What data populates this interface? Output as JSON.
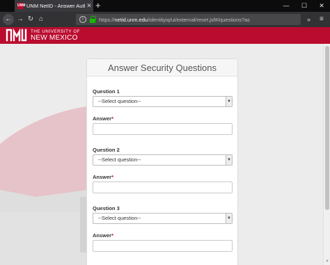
{
  "browser": {
    "tab_title": "UNM NetID - Answer Authentic",
    "favicon_text": "UNM",
    "new_tab_label": "+",
    "url_host": "netid.unm.edu",
    "url_prefix": "https://",
    "url_rest": "/identityiq/ui/external/reset.jsf#/questions?ac",
    "overflow_label": "»",
    "menu_label": "≡",
    "minimize_label": "—",
    "maximize_label": "☐",
    "close_label": "✕"
  },
  "header": {
    "logo_line1": "THE UNIVERSITY OF",
    "logo_line2": "NEW MEXICO",
    "brand_color": "#ba0c2f"
  },
  "form": {
    "title": "Answer Security Questions",
    "required_marker": "*",
    "questions": [
      {
        "label": "Question 1",
        "select_value": "--Select question--",
        "answer_label": "Answer"
      },
      {
        "label": "Question 2",
        "select_value": "--Select question--",
        "answer_label": "Answer"
      },
      {
        "label": "Question 3",
        "select_value": "--Select question--",
        "answer_label": "Answer"
      }
    ]
  }
}
